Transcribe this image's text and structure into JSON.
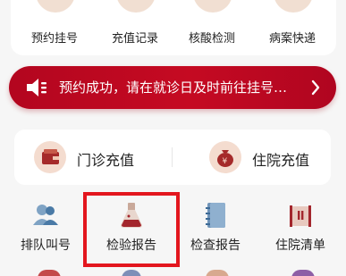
{
  "top_menu": [
    {
      "label": "预约挂号",
      "icon": "calendar-icon"
    },
    {
      "label": "充值记录",
      "icon": "money-bag-icon"
    },
    {
      "label": "核酸检测",
      "icon": "test-kit-icon"
    },
    {
      "label": "病案快递",
      "icon": "delivery-icon"
    }
  ],
  "banner": {
    "text": "预约成功，请在就诊日及时前往挂号…",
    "icon": "speaker-icon",
    "arrow": "chevron-right-icon"
  },
  "recharge": {
    "outpatient_label": "门诊充值",
    "inpatient_label": "住院充值",
    "outpatient_icon": "wallet-icon",
    "inpatient_icon": "money-bag-icon"
  },
  "services": [
    {
      "label": "排队叫号",
      "icon": "people-icon"
    },
    {
      "label": "检验报告",
      "icon": "flask-icon"
    },
    {
      "label": "检查报告",
      "icon": "notebook-icon"
    },
    {
      "label": "住院清单",
      "icon": "list-icon"
    }
  ],
  "colors": {
    "brand_red": "#b3061f",
    "highlight_border": "#e3161e",
    "icon_bg": "#f1dfd2"
  }
}
